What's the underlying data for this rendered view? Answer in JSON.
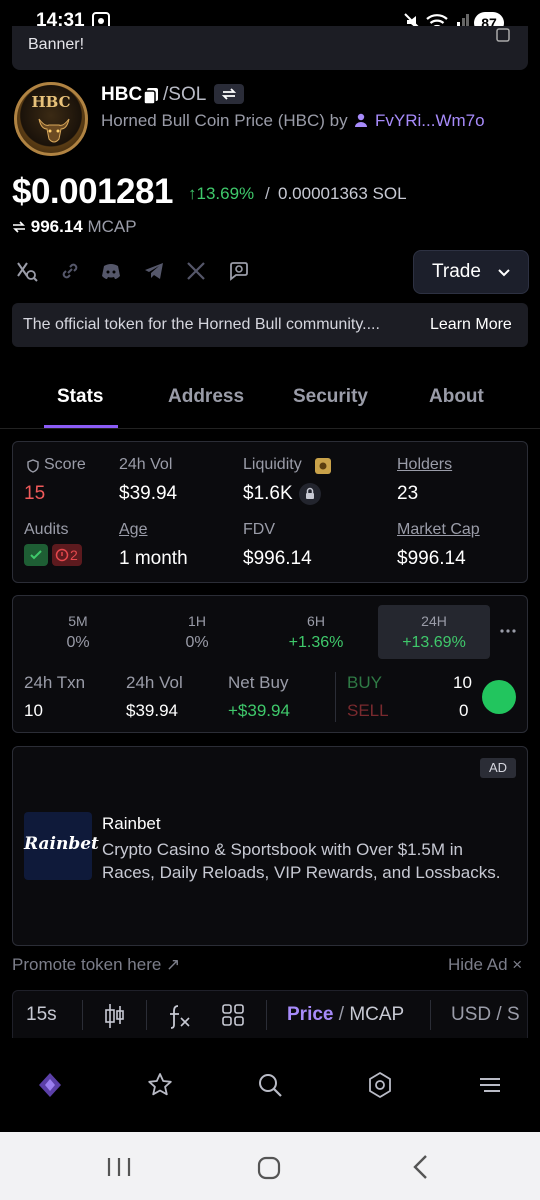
{
  "status_bar": {
    "time": "14:31",
    "battery": "87"
  },
  "banner": {
    "text": "Banner!"
  },
  "token": {
    "logo_text": "HBC",
    "symbol": "HBC",
    "quote": "/SOL",
    "description": "Horned Bull Coin Price (HBC) by",
    "creator": "FvYRi...Wm7o",
    "price": "$0.001281",
    "change": "↑13.69%",
    "separator": "/",
    "price_sol": "0.00001363 SOL",
    "mcap_value": "996.14",
    "mcap_label": "MCAP"
  },
  "trade_button": {
    "label": "Trade"
  },
  "about_box": {
    "text": "The official token for the Horned Bull community....",
    "link": "Learn More"
  },
  "tabs": [
    "Stats",
    "Address",
    "Security",
    "About"
  ],
  "stats": {
    "score_label": "Score",
    "score_value": "15",
    "vol_label": "24h Vol",
    "vol_value": "$39.94",
    "liquidity_label": "Liquidity",
    "liquidity_value": "$1.6K",
    "holders_label": "Holders",
    "holders_value": "23",
    "audits_label": "Audits",
    "audits_fail_count": "2",
    "age_label": "Age",
    "age_value": "1 month",
    "fdv_label": "FDV",
    "fdv_value": "$996.14",
    "mcap_label": "Market Cap",
    "mcap_value": "$996.14"
  },
  "timeframes": [
    {
      "label": "5M",
      "value": "0%"
    },
    {
      "label": "1H",
      "value": "0%"
    },
    {
      "label": "6H",
      "value": "+1.36%"
    },
    {
      "label": "24H",
      "value": "+13.69%"
    }
  ],
  "activity": {
    "txn_label": "24h Txn",
    "txn_value": "10",
    "vol_label": "24h Vol",
    "vol_value": "$39.94",
    "netbuy_label": "Net Buy",
    "netbuy_value": "+$39.94",
    "buy_label": "BUY",
    "buy_count": "10",
    "sell_label": "SELL",
    "sell_count": "0"
  },
  "ad": {
    "badge": "AD",
    "logo_text": "Rainbet",
    "title": "Rainbet",
    "body": "Crypto Casino & Sportsbook with Over $1.5M in Races, Daily Reloads, VIP Rewards, and Lossbacks."
  },
  "promote": {
    "text": "Promote token here ↗",
    "hide": "Hide Ad ×"
  },
  "chart_toolbar": {
    "interval": "15s",
    "price_label": "Price",
    "toggle_sep": " / ",
    "mcap_label": "MCAP",
    "currency": "USD / S"
  },
  "colors": {
    "accent": "#8b5cf6",
    "positive": "#3fc96b",
    "negative": "#e5484d"
  }
}
